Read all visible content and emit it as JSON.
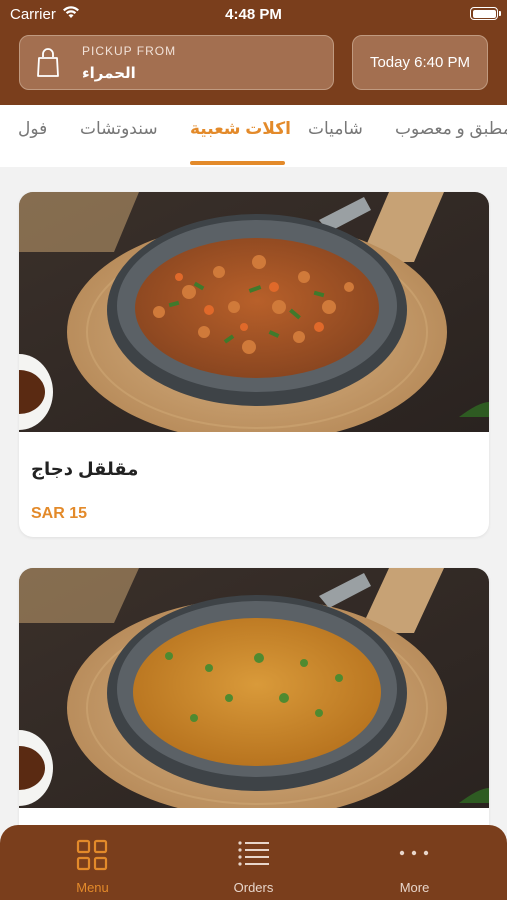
{
  "status_bar": {
    "carrier": "Carrier",
    "time": "4:48 PM"
  },
  "header": {
    "pickup_label": "PICKUP FROM",
    "pickup_location": "الحمراء",
    "pickup_time": "Today 6:40 PM"
  },
  "tabs": [
    {
      "label": "فول",
      "active": false
    },
    {
      "label": "سندوتشات",
      "active": false
    },
    {
      "label": "اكلات شعبية",
      "active": true
    },
    {
      "label": "شاميات",
      "active": false
    },
    {
      "label": "مطبق و معصوب",
      "active": false
    }
  ],
  "items": [
    {
      "name": "مقلقل دجاج",
      "price": "SAR 15",
      "image": "pan-with-chicken-cubes"
    },
    {
      "name": "",
      "price": "",
      "image": "pan-with-lentil-stew"
    }
  ],
  "bottom_nav": [
    {
      "label": "Menu",
      "icon": "grid-icon",
      "active": true
    },
    {
      "label": "Orders",
      "icon": "list-icon",
      "active": false
    },
    {
      "label": "More",
      "icon": "ellipsis-icon",
      "active": false
    }
  ],
  "colors": {
    "brand_brown": "#7a3e1c",
    "accent_orange": "#e38a2a",
    "box_brown": "#a36f50"
  }
}
